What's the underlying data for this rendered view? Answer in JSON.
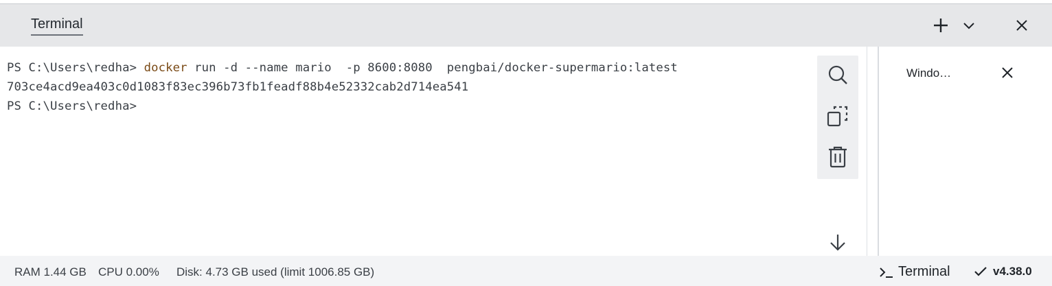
{
  "header": {
    "tab_label": "Terminal",
    "icons": {
      "add": "plus-icon",
      "dropdown": "chevron-down-icon",
      "close": "close-icon"
    }
  },
  "terminal": {
    "prompt1": "PS C:\\Users\\redha> ",
    "cmd_word": "docker",
    "cmd_args": " run -d --name mario  -p 8600:8080  pengbai/docker-supermario:latest",
    "output": "703ce4acd9ea403c0d1083f83ec396b73fb1feadf88b4e52332cab2d714ea541",
    "prompt2": "PS C:\\Users\\redha>",
    "tools": [
      "search-icon",
      "copy-icon",
      "trash-icon"
    ],
    "scroll_icon": "arrow-down-icon"
  },
  "side_panel": {
    "label": "Windo…",
    "close_icon": "close-icon"
  },
  "status": {
    "ram": "RAM 1.44 GB",
    "cpu": "CPU 0.00%",
    "disk": "Disk: 4.73 GB used (limit 1006.85 GB)",
    "terminal_label": "Terminal",
    "terminal_icon": "terminal-prompt-icon",
    "version": "v4.38.0",
    "version_icon": "check-icon"
  },
  "colors": {
    "header_bg": "#e6e7e9",
    "command_color": "#7a4a16",
    "status_bg": "#f3f4f6"
  }
}
